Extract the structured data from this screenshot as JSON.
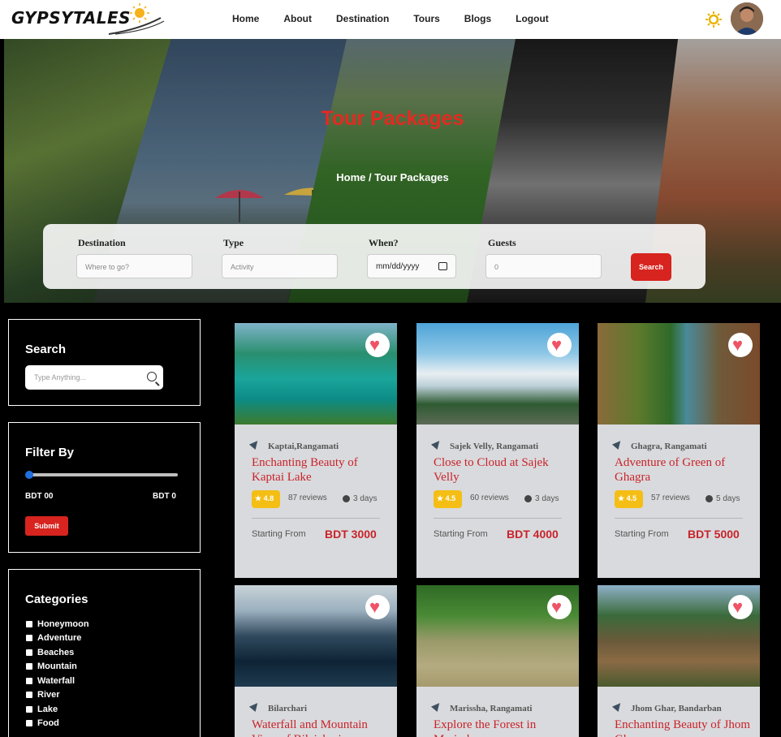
{
  "brand": {
    "name": "GYPSYTALES"
  },
  "nav": {
    "links": [
      "Home",
      "About",
      "Destination",
      "Tours",
      "Blogs",
      "Logout"
    ],
    "theme_icon": "sun-icon",
    "avatar_icon": "user-avatar"
  },
  "hero": {
    "title": "Tour Packages",
    "breadcrumb": "Home / Tour Packages"
  },
  "search_form": {
    "destination": {
      "label": "Destination",
      "placeholder": "Where to go?"
    },
    "type": {
      "label": "Type",
      "placeholder": "Activity"
    },
    "when": {
      "label": "When?",
      "value": "mm/dd/yyyy"
    },
    "guests": {
      "label": "Guests",
      "value": "0"
    },
    "button": "Search"
  },
  "sidebar": {
    "search": {
      "title": "Search",
      "placeholder": "Type Anything..."
    },
    "filter": {
      "title": "Filter By",
      "min": "BDT 00",
      "max": "BDT 0",
      "submit": "Submit",
      "slider_value": 0
    },
    "categories": {
      "title": "Categories",
      "items": [
        "Honeymoon",
        "Adventure",
        "Beaches",
        "Mountain",
        "Waterfall",
        "River",
        "Lake",
        "Food"
      ]
    }
  },
  "tours": [
    {
      "location": "Kaptai,Rangamati",
      "title": "Enchanting Beauty of Kaptai Lake",
      "rating": "4.8",
      "reviews": "87 reviews",
      "duration": "3 days",
      "start_label": "Starting From",
      "price": "BDT 3000"
    },
    {
      "location": "Sajek Velly, Rangamati",
      "title": "Close to Cloud at Sajek Velly",
      "rating": "4.5",
      "reviews": "60 reviews",
      "duration": "3 days",
      "start_label": "Starting From",
      "price": "BDT 4000"
    },
    {
      "location": "Ghagra, Rangamati",
      "title": "Adventure of Green of Ghagra",
      "rating": "4.5",
      "reviews": "57 reviews",
      "duration": "5 days",
      "start_label": "Starting From",
      "price": "BDT 5000"
    },
    {
      "location": "Bilarchari",
      "title": "Waterfall and Mountain View of Bilaichari",
      "rating": "",
      "reviews": "",
      "duration": "",
      "start_label": "",
      "price": ""
    },
    {
      "location": "Marissha, Rangamati",
      "title": "Explore the Forest in Marissha",
      "rating": "",
      "reviews": "",
      "duration": "",
      "start_label": "",
      "price": ""
    },
    {
      "location": "Jhom Ghar, Bandarban",
      "title": "Enchanting Beauty of Jhom Ghar",
      "rating": "",
      "reviews": "",
      "duration": "",
      "start_label": "",
      "price": ""
    }
  ],
  "colors": {
    "accent": "#d7241f",
    "rating": "#f4be15",
    "heart": "#ef5366"
  }
}
